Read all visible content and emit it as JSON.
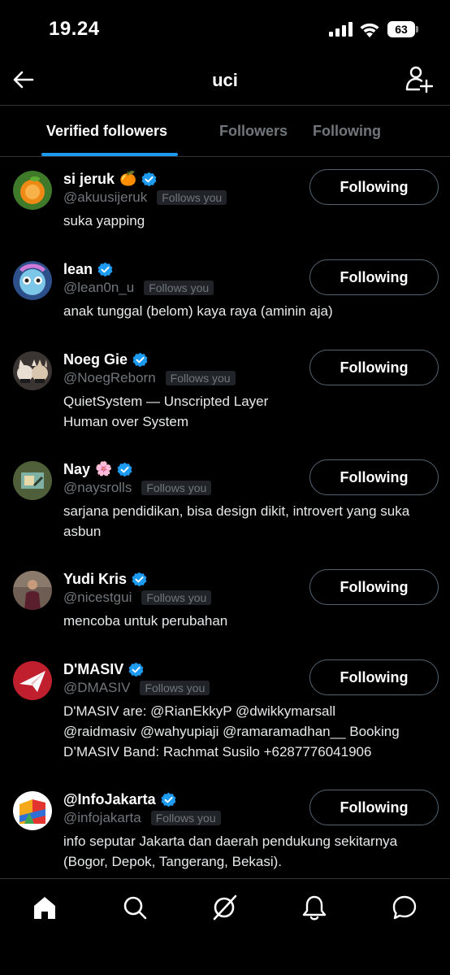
{
  "status_bar": {
    "time": "19.24",
    "battery": "63"
  },
  "header": {
    "title": "uci",
    "back_icon": "arrow-left-icon",
    "add_icon": "add-user-icon"
  },
  "tabs": [
    {
      "label": "Verified followers",
      "active": true
    },
    {
      "label": "Followers",
      "active": false
    },
    {
      "label": "Following",
      "active": false
    }
  ],
  "accent_color": "#1d9bf0",
  "users": [
    {
      "name": "si jeruk",
      "emoji": "🍊",
      "handle": "@akuusijeruk",
      "follows_you": "Follows you",
      "bio": "suka yapping",
      "button": "Following"
    },
    {
      "name": "lean",
      "emoji": "",
      "handle": "@lean0n_u",
      "follows_you": "Follows you",
      "bio": "anak tunggal (belom) kaya raya (aminin aja)",
      "button": "Following"
    },
    {
      "name": "Noeg Gie",
      "emoji": "",
      "handle": "@NoegReborn",
      "follows_you": "Follows you",
      "bio_lines": [
        "QuietSystem — Unscripted Layer",
        "Human over System"
      ],
      "button": "Following"
    },
    {
      "name": "Nay",
      "emoji": "🌸",
      "handle": "@naysrolls",
      "follows_you": "Follows you",
      "bio": "sarjana pendidikan, bisa design dikit, introvert yang suka asbun",
      "button": "Following"
    },
    {
      "name": "Yudi Kris",
      "emoji": "",
      "handle": "@nicestgui",
      "follows_you": "Follows you",
      "bio": "mencoba untuk perubahan",
      "button": "Following"
    },
    {
      "name": "D'MASIV",
      "emoji": "",
      "handle": "@DMASIV",
      "follows_you": "Follows you",
      "bio_lines": [
        "D'MASIV are: @RianEkkyP @dwikkymarsall",
        "@raidmasiv @wahyupiaji @ramaramadhan__ Booking",
        "D’MASIV Band: Rachmat Susilo +6287776041906"
      ],
      "button": "Following"
    },
    {
      "name": "@InfoJakarta",
      "emoji": "",
      "handle": "@infojakarta",
      "follows_you": "Follows you",
      "bio": "info seputar Jakarta dan daerah pendukung sekitarnya (Bogor, Depok, Tangerang, Bekasi).",
      "button": "Following"
    }
  ],
  "bottom_nav": [
    {
      "icon": "home-icon",
      "active": true
    },
    {
      "icon": "search-icon",
      "active": false
    },
    {
      "icon": "grok-icon",
      "active": false
    },
    {
      "icon": "bell-icon",
      "active": false
    },
    {
      "icon": "message-icon",
      "active": false
    }
  ]
}
